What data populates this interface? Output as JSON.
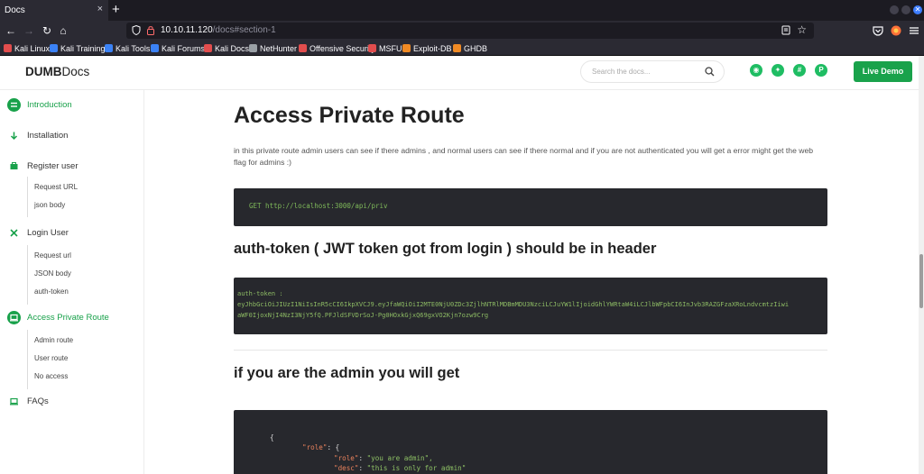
{
  "browser": {
    "tab_title": "Docs",
    "tab_close": "×",
    "new_tab": "+",
    "url_host": "10.10.11.120",
    "url_path": "/docs#section-1",
    "back": "←",
    "forward": "→",
    "reload": "↻",
    "home": "⌂",
    "star": "☆",
    "close_window": "✕",
    "bookmarks": [
      {
        "label": "Kali Linux",
        "color": "#e24d4d"
      },
      {
        "label": "Kali Training",
        "color": "#3b82f6"
      },
      {
        "label": "Kali Tools",
        "color": "#3b82f6"
      },
      {
        "label": "Kali Forums",
        "color": "#3b82f6"
      },
      {
        "label": "Kali Docs",
        "color": "#e24d4d"
      },
      {
        "label": "NetHunter",
        "color": "#9aa0a6"
      },
      {
        "label": "Offensive Security",
        "color": "#e24d4d"
      },
      {
        "label": "MSFU",
        "color": "#e24d4d"
      },
      {
        "label": "Exploit-DB",
        "color": "#f08a24"
      },
      {
        "label": "GHDB",
        "color": "#f08a24"
      }
    ]
  },
  "header": {
    "logo_bold": "DUMB",
    "logo_rest": "Docs",
    "search_placeholder": "Search the docs...",
    "social": [
      "github-icon",
      "twitter-icon",
      "slack-icon",
      "product-hunt-icon"
    ],
    "live_demo": "Live Demo"
  },
  "sidebar": {
    "sections": [
      {
        "label": "Introduction",
        "icon": "intro-icon",
        "active": true
      },
      {
        "label": "Installation",
        "icon": "download-arrow-icon",
        "active": false
      },
      {
        "label": "Register user",
        "icon": "box-icon",
        "active": false
      },
      {
        "label": "Login User",
        "icon": "tools-icon",
        "active": false
      },
      {
        "label": "Access Private Route",
        "icon": "laptop-icon",
        "active": true
      },
      {
        "label": "FAQs",
        "icon": "laptop-icon",
        "active": false
      }
    ],
    "register_subs": [
      "Request URL",
      "json body"
    ],
    "login_subs": [
      "Request url",
      "JSON body",
      "auth-token"
    ],
    "private_subs": [
      "Admin route",
      "User route",
      "No access"
    ]
  },
  "content": {
    "title": "Access Private Route",
    "paragraph": "in this private route admin users can see if there admins , and normal users can see if there normal and if you are not authenticated you will get a error might get the web flag for admins :)",
    "code_get": "GET http://localhost:3000/api/priv",
    "auth_heading": "auth-token ( JWT token got from login ) should be in header",
    "auth_code_lines": [
      "auth-token :",
      "eyJhbGciOiJIUzI1NiIsInR5cCI6IkpXVCJ9.eyJfaWQiOiI2MTE0NjU0ZDc3ZjlhNTRlMDBmMDU3NzciLCJuYW1lIjoidGhlYWRtaW4iLCJlbWFpbCI6InJvb3RAZGFzaXRoLndvcmtzIiwi",
      "aWF0IjoxNjI4NzI3NjY5fQ.PFJldSFVDrSoJ-Pg0HOxkGjxQ69gxVO2Kjn7ozw9Crg"
    ],
    "admin_heading": "if you are the admin you will get",
    "json_open": "{",
    "json_role_key": "\"role\"",
    "json_role_open": ": {",
    "json_role_inner_key": "\"role\"",
    "json_role_inner_val": "\"you are admin\",",
    "json_desc_key": "\"desc\"",
    "json_desc_val": "\"this is only for admin\""
  }
}
